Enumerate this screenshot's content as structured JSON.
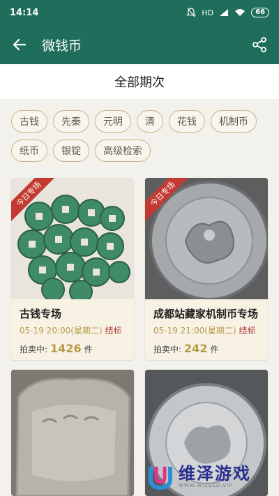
{
  "status_bar": {
    "time": "14:14",
    "network": "HD",
    "battery": "66"
  },
  "app_bar": {
    "title": "微钱币",
    "back_icon": "arrow-left-icon",
    "share_icon": "share-icon"
  },
  "section": {
    "title": "全部期次"
  },
  "tags": [
    "古钱",
    "先秦",
    "元明",
    "清",
    "花钱",
    "机制币",
    "纸币",
    "银锭",
    "高级检索"
  ],
  "cards": [
    {
      "ribbon": "今日专场",
      "title": "古钱专场",
      "time": "05-19 20:00(星期二)",
      "status": "结标",
      "count_label": "拍卖中:",
      "count": "1426",
      "unit": "件"
    },
    {
      "ribbon": "今日专场",
      "title": "成都站藏家机制币专场",
      "time": "05-19 21:00(星期二)",
      "status": "结标",
      "count_label": "拍卖中:",
      "count": "242",
      "unit": "件"
    },
    {
      "image": "silver-ingot-image"
    },
    {
      "image": "silver-dragon-coin-image"
    }
  ],
  "watermark": {
    "main": "维泽游戏",
    "sub": "WWW.WIZEED.VIP"
  },
  "colors": {
    "primary": "#1f6e5c",
    "accent_gold": "#b79a4a",
    "accent_red": "#b2393a",
    "ribbon": "#c33a32"
  }
}
